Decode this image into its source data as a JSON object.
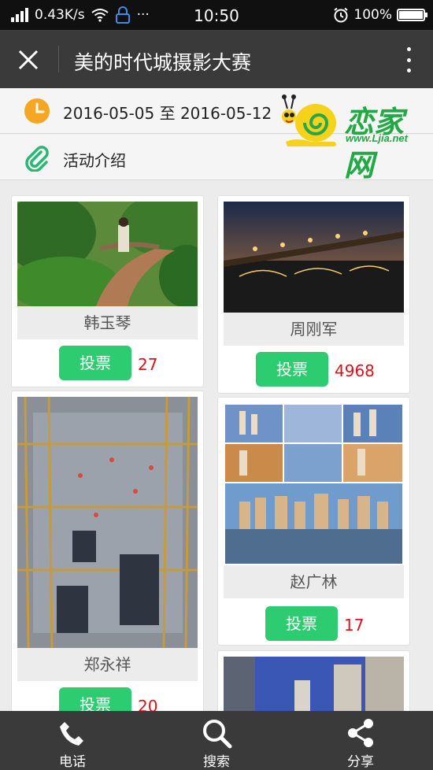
{
  "status_bar": {
    "net_speed": "0.43K/s",
    "dots": "···",
    "time": "10:50",
    "battery": "100%"
  },
  "app_bar": {
    "title": "美的时代城摄影大赛"
  },
  "event": {
    "date_range": "2016-05-05 至 2016-05-12",
    "intro_label": "活动介绍"
  },
  "logo": {
    "brand": "恋家网",
    "url": "www.Ljia.net",
    "color": "#22a845"
  },
  "vote_label": "投票",
  "entries": [
    {
      "name": "韩玉琴",
      "votes": "27",
      "photo": "garden path"
    },
    {
      "name": "周刚军",
      "votes": "4968",
      "photo": "bridge at night"
    },
    {
      "name": "郑永祥",
      "votes": "20",
      "photo": "construction site"
    },
    {
      "name": "赵广林",
      "votes": "17",
      "photo": "city buildings collage"
    },
    {
      "name": "",
      "votes": "",
      "photo": "tall apartment towers"
    }
  ],
  "bottom_nav": [
    {
      "label": "电话",
      "icon": "phone-icon"
    },
    {
      "label": "搜索",
      "icon": "search-icon"
    },
    {
      "label": "分享",
      "icon": "share-icon"
    }
  ],
  "colors": {
    "accent_green": "#2ecc71",
    "vote_count_red": "#e0101a",
    "toolbar": "#3a3a3a",
    "clock_orange": "#f5a623",
    "clip_green": "#2bb673"
  }
}
